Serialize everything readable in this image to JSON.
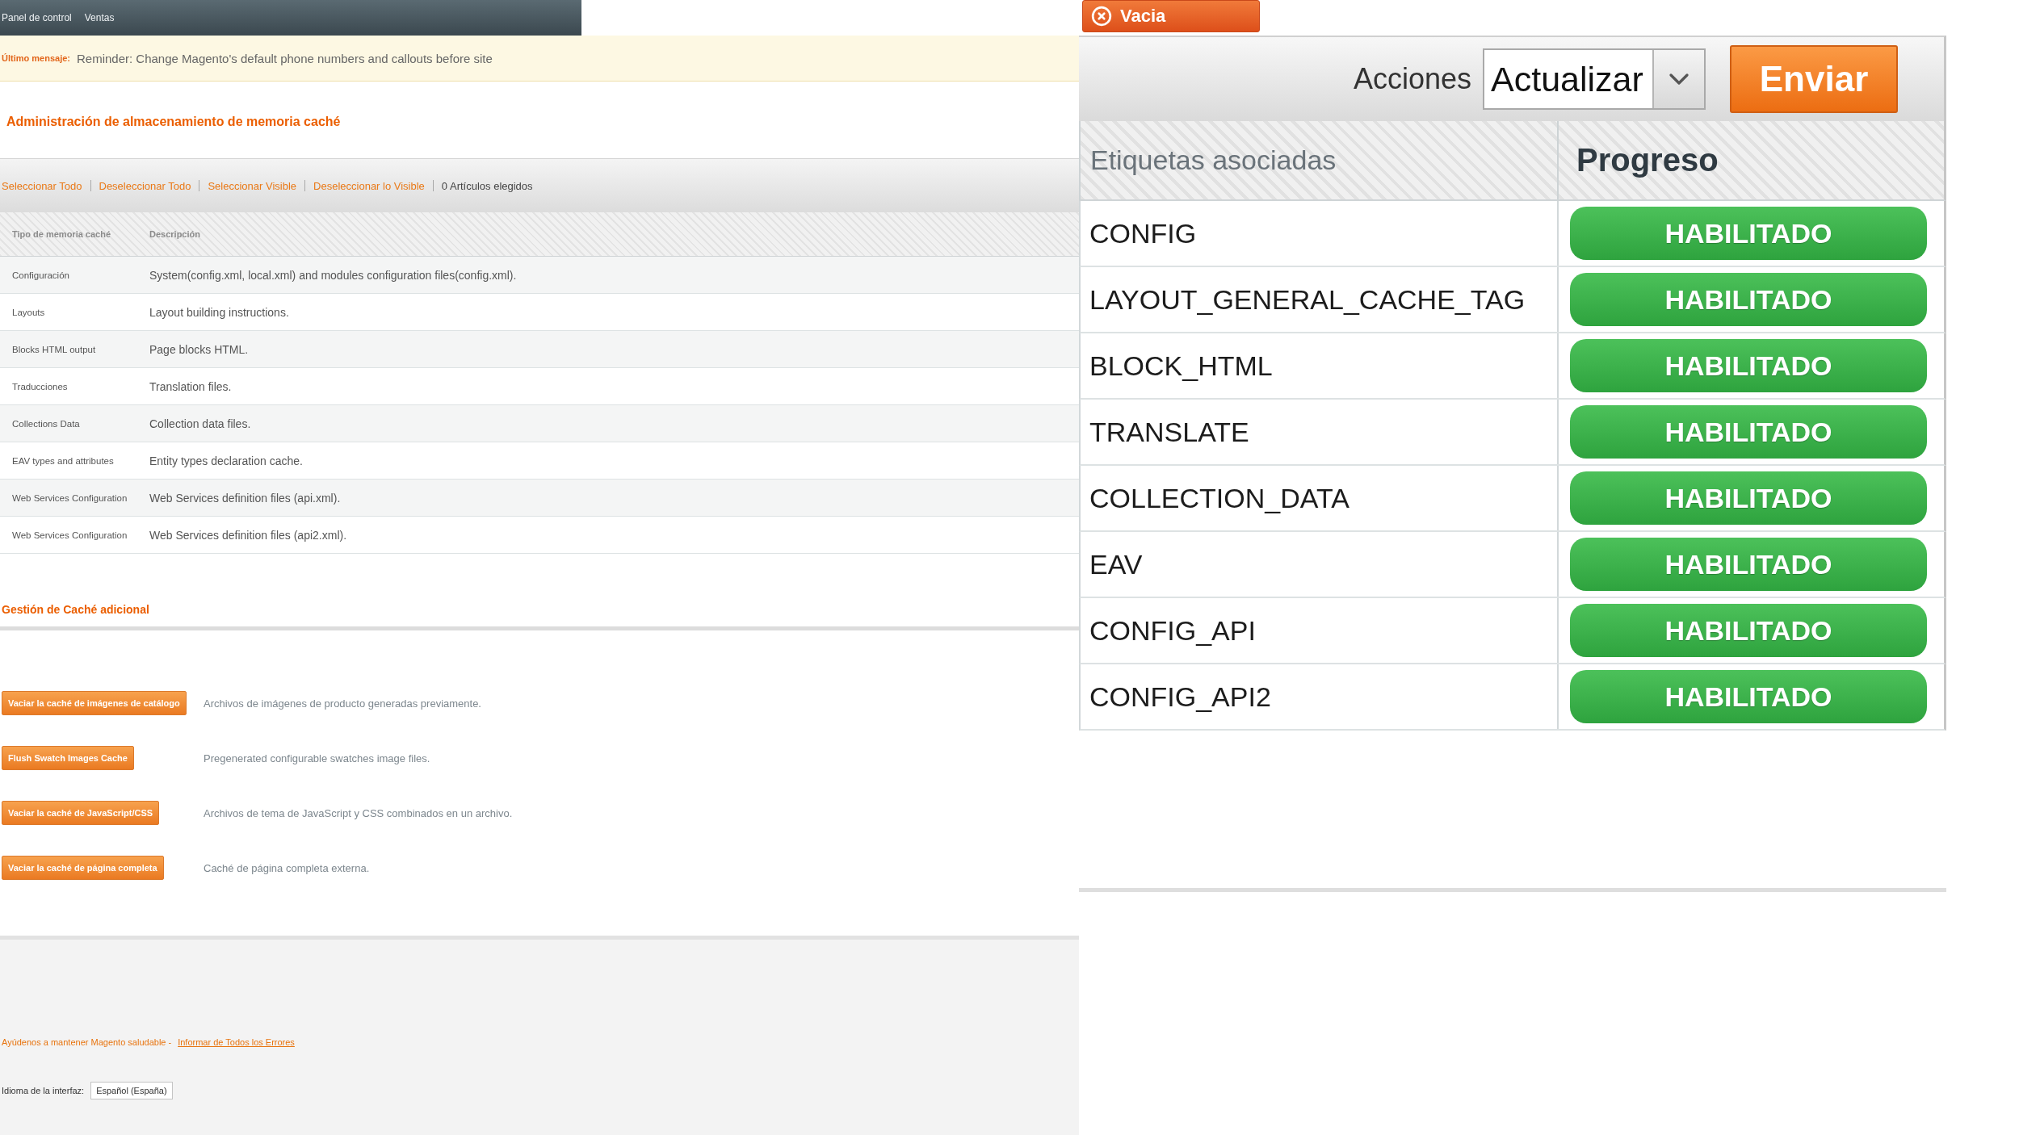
{
  "nav": {
    "items": [
      {
        "label": "Panel de control"
      },
      {
        "label": "Ventas"
      }
    ]
  },
  "notification": {
    "label": "Último mensaje:",
    "text": "Reminder: Change Magento's default phone numbers and callouts before site"
  },
  "page_header": {
    "title": "Administración de almacenamiento de memoria caché",
    "button": "Vacia"
  },
  "massaction": {
    "links": [
      "Seleccionar Todo",
      "Deseleccionar Todo",
      "Seleccionar Visible",
      "Deseleccionar lo Visible"
    ],
    "count": "0 Artículos elegidos",
    "actions_label": "Acciones",
    "action": "Actualizar",
    "submit": "Enviar"
  },
  "table": {
    "columns": [
      "Tipo de memoria caché",
      "Descripción",
      "Etiquetas asociadas",
      "Progreso"
    ],
    "rows": [
      {
        "type": "Configuración",
        "description": "System(config.xml, local.xml) and modules configuration files(config.xml).",
        "tags": "CONFIG",
        "status": "HABILITADO",
        "enabled": true
      },
      {
        "type": "Layouts",
        "description": "Layout building instructions.",
        "tags": "LAYOUT_GENERAL_CACHE_TAG",
        "status": "HABILITADO",
        "enabled": true
      },
      {
        "type": "Blocks HTML output",
        "description": "Page blocks HTML.",
        "tags": "BLOCK_HTML",
        "status": "HABILITADO",
        "enabled": true
      },
      {
        "type": "Traducciones",
        "description": "Translation files.",
        "tags": "TRANSLATE",
        "status": "HABILITADO",
        "enabled": true
      },
      {
        "type": "Collections Data",
        "description": "Collection data files.",
        "tags": "COLLECTION_DATA",
        "status": "HABILITADO",
        "enabled": true
      },
      {
        "type": "EAV types and attributes",
        "description": "Entity types declaration cache.",
        "tags": "EAV",
        "status": "HABILITADO",
        "enabled": true
      },
      {
        "type": "Web Services Configuration",
        "description": "Web Services definition files (api.xml).",
        "tags": "CONFIG_API",
        "status": "HABILITADO",
        "enabled": true
      },
      {
        "type": "Web Services Configuration",
        "description": "Web Services definition files (api2.xml).",
        "tags": "CONFIG_API2",
        "status": "HABILITADO",
        "enabled": true
      }
    ]
  },
  "additional_cache": {
    "title": "Gestión de Caché adicional",
    "items": [
      {
        "button": "Vaciar la caché de imágenes de catálogo",
        "description": "Archivos de imágenes de producto generadas previamente."
      },
      {
        "button": "Flush Swatch Images Cache",
        "description": "Pregenerated configurable swatches image files."
      },
      {
        "button": "Vaciar la caché de JavaScript/CSS",
        "description": "Archivos de tema de JavaScript y CSS combinados en un archivo."
      },
      {
        "button": "Vaciar la caché de página completa",
        "description": "Caché de página completa externa."
      }
    ]
  },
  "footer": {
    "text": "Ayúdenos a mantener Magento saludable -",
    "link": "Informar de Todos los Errores",
    "locale_label": "Idioma de la interfaz:",
    "locale": "Español (España)"
  }
}
